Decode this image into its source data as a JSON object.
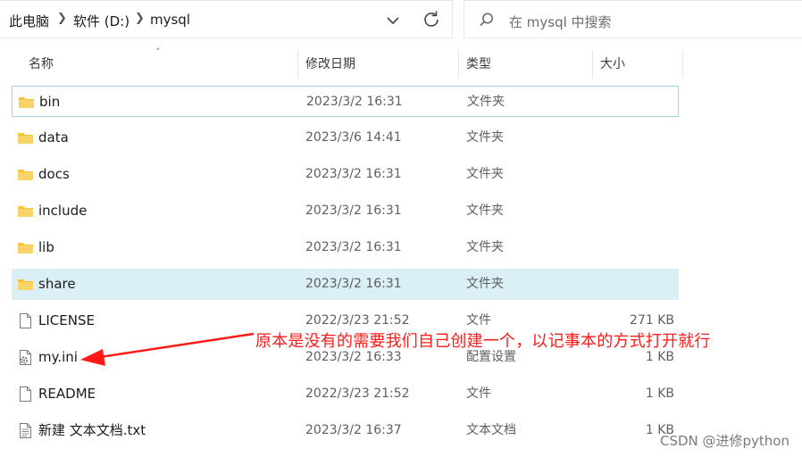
{
  "address_bar": {
    "breadcrumbs": [
      "此电脑",
      "软件 (D:)",
      "mysql"
    ]
  },
  "search": {
    "placeholder": "在 mysql 中搜索"
  },
  "columns": {
    "name": "名称",
    "date": "修改日期",
    "type": "类型",
    "size": "大小"
  },
  "files": [
    {
      "name": "bin",
      "date": "2023/3/2 16:31",
      "type": "文件夹",
      "size": "",
      "icon": "folder-icon"
    },
    {
      "name": "data",
      "date": "2023/3/6 14:41",
      "type": "文件夹",
      "size": "",
      "icon": "folder-icon"
    },
    {
      "name": "docs",
      "date": "2023/3/2 16:31",
      "type": "文件夹",
      "size": "",
      "icon": "folder-icon"
    },
    {
      "name": "include",
      "date": "2023/3/2 16:31",
      "type": "文件夹",
      "size": "",
      "icon": "folder-icon"
    },
    {
      "name": "lib",
      "date": "2023/3/2 16:31",
      "type": "文件夹",
      "size": "",
      "icon": "folder-icon"
    },
    {
      "name": "share",
      "date": "2023/3/2 16:31",
      "type": "文件夹",
      "size": "",
      "icon": "folder-icon"
    },
    {
      "name": "LICENSE",
      "date": "2022/3/23 21:52",
      "type": "文件",
      "size": "271 KB",
      "icon": "file-icon"
    },
    {
      "name": "my.ini",
      "date": "2023/3/2 16:33",
      "type": "配置设置",
      "size": "1 KB",
      "icon": "settings-file-icon"
    },
    {
      "name": "README",
      "date": "2022/3/23 21:52",
      "type": "文件",
      "size": "1 KB",
      "icon": "file-icon"
    },
    {
      "name": "新建 文本文档.txt",
      "date": "2023/3/2 16:37",
      "type": "文本文档",
      "size": "1 KB",
      "icon": "text-file-icon"
    }
  ],
  "annotation": {
    "text": "原本是没有的需要我们自己创建一个，以记事本的方式打开就行",
    "color": "#ff1a1a"
  },
  "watermark": "CSDN @进修python",
  "colors": {
    "folder": "#f4c43a",
    "selection": "#dbeff7",
    "focus_border": "#9ed3e3"
  }
}
